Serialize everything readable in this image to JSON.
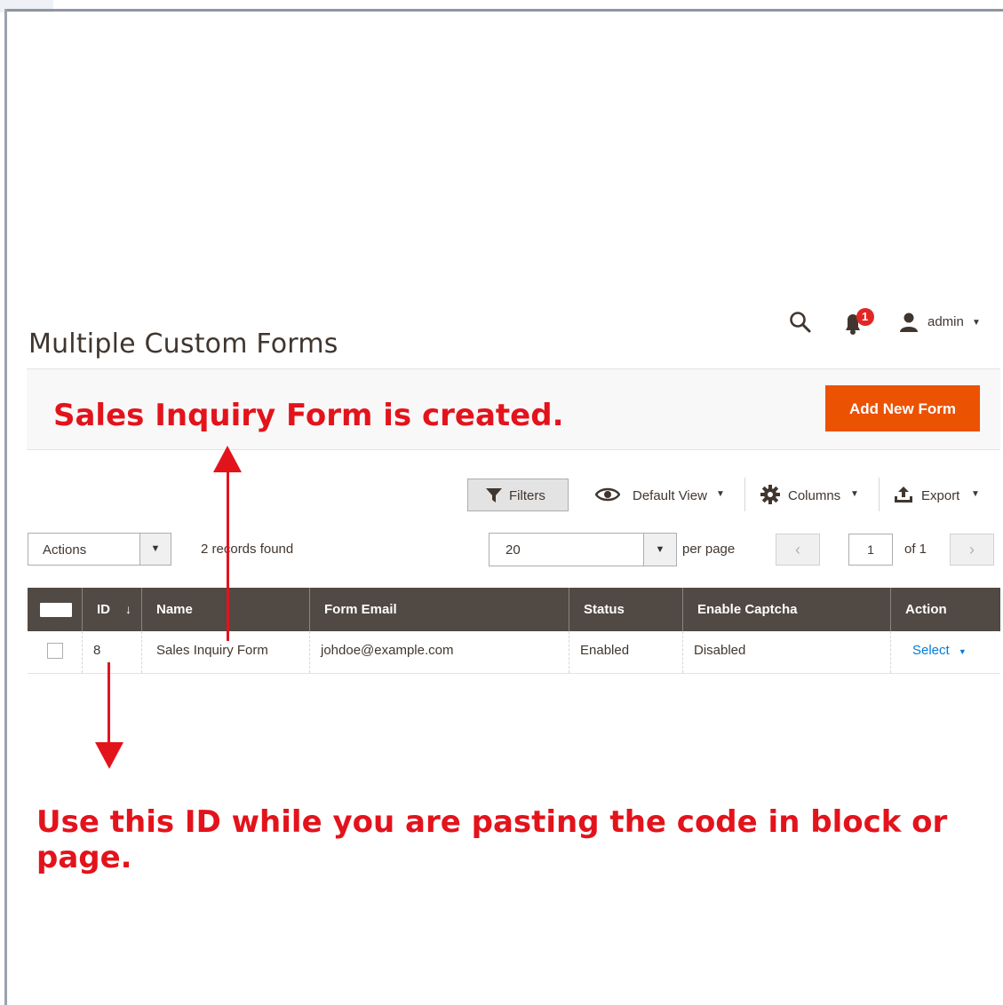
{
  "page": {
    "title": "Multiple Custom Forms"
  },
  "header": {
    "admin_label": "admin",
    "notification_count": "1"
  },
  "annotations": {
    "top": "Sales Inquiry Form is created.",
    "bottom": "Use this ID while you are pasting the code in block or page."
  },
  "actions_bar": {
    "add_new_label": "Add New Form"
  },
  "toolbar": {
    "filters_label": "Filters",
    "default_view_label": "Default View",
    "columns_label": "Columns",
    "export_label": "Export"
  },
  "grid_controls": {
    "actions_label": "Actions",
    "records_found": "2 records found",
    "per_page_value": "20",
    "per_page_label": "per page",
    "current_page": "1",
    "of_pages": "of 1"
  },
  "table": {
    "columns": [
      "ID",
      "Name",
      "Form Email",
      "Status",
      "Enable Captcha",
      "Action"
    ],
    "rows": [
      {
        "id": "8",
        "name": "Sales Inquiry Form",
        "email": "johdoe@example.com",
        "status": "Enabled",
        "captcha": "Disabled",
        "action": "Select"
      }
    ]
  },
  "colors": {
    "accent": "#eb5202",
    "annotation": "#e3131c",
    "grid_header": "#514943",
    "link": "#007bdb"
  }
}
